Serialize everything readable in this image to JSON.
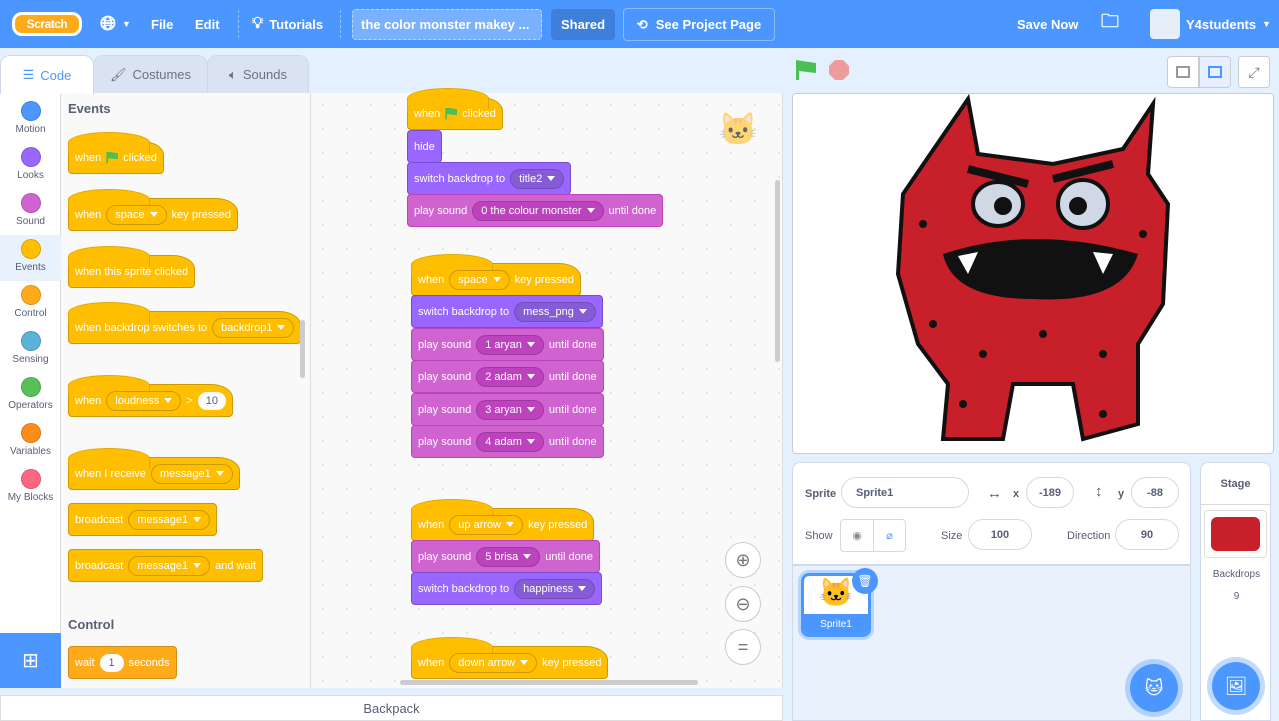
{
  "menubar": {
    "logo": "Scratch",
    "file": "File",
    "edit": "Edit",
    "tutorials": "Tutorials",
    "project_title": "the color monster makey ...",
    "shared": "Shared",
    "see_project_page": "See Project Page",
    "save_now": "Save Now",
    "username": "Y4students"
  },
  "tabs": [
    "Code",
    "Costumes",
    "Sounds"
  ],
  "categories": [
    {
      "label": "Motion",
      "color": "#4C97FF"
    },
    {
      "label": "Looks",
      "color": "#9966FF"
    },
    {
      "label": "Sound",
      "color": "#CF63CF"
    },
    {
      "label": "Events",
      "color": "#FFBF00"
    },
    {
      "label": "Control",
      "color": "#FFAB19"
    },
    {
      "label": "Sensing",
      "color": "#5CB1D6"
    },
    {
      "label": "Operators",
      "color": "#59C059"
    },
    {
      "label": "Variables",
      "color": "#FF8C1A"
    },
    {
      "label": "My Blocks",
      "color": "#FF6680"
    }
  ],
  "palette": {
    "events_heading": "Events",
    "control_heading": "Control",
    "blocks": [
      [
        {
          "t": "when"
        },
        {
          "icon": "flag"
        },
        {
          "t": "clicked"
        }
      ],
      [
        {
          "t": "when"
        },
        {
          "dd": "space"
        },
        {
          "t": "key pressed"
        }
      ],
      [
        {
          "t": "when this sprite clicked"
        }
      ],
      [
        {
          "t": "when backdrop switches to"
        },
        {
          "dd": "backdrop1"
        }
      ],
      [
        {
          "t": "when"
        },
        {
          "dd": "loudness"
        },
        {
          "t": ">"
        },
        {
          "num": "10"
        }
      ],
      [
        {
          "t": "when I receive"
        },
        {
          "dd": "message1"
        }
      ],
      [
        {
          "t": "broadcast"
        },
        {
          "dd": "message1"
        }
      ],
      [
        {
          "t": "broadcast"
        },
        {
          "dd": "message1"
        },
        {
          "t": "and wait"
        }
      ],
      [
        {
          "t": "wait"
        },
        {
          "num": "1"
        },
        {
          "t": "seconds"
        }
      ]
    ]
  },
  "scripts": [
    [
      {
        "t": "when"
      },
      {
        "icon": "flag"
      },
      {
        "t": "clicked"
      }
    ],
    [
      {
        "t": "hide"
      }
    ],
    [
      {
        "t": "switch backdrop to"
      },
      {
        "dd": "title2"
      }
    ],
    [
      {
        "t": "play sound"
      },
      {
        "dd": "0 the colour monster"
      },
      {
        "t": "until done"
      }
    ],
    [
      {
        "t": "when"
      },
      {
        "dd": "space"
      },
      {
        "t": "key pressed"
      }
    ],
    [
      {
        "t": "switch backdrop to"
      },
      {
        "dd": "mess_png"
      }
    ],
    [
      {
        "t": "play sound"
      },
      {
        "dd": "1 aryan"
      },
      {
        "t": "until done"
      }
    ],
    [
      {
        "t": "play sound"
      },
      {
        "dd": "2 adam"
      },
      {
        "t": "until done"
      }
    ],
    [
      {
        "t": "play sound"
      },
      {
        "dd": "3 aryan"
      },
      {
        "t": "until done"
      }
    ],
    [
      {
        "t": "play sound"
      },
      {
        "dd": "4 adam"
      },
      {
        "t": "until done"
      }
    ],
    [
      {
        "t": "when"
      },
      {
        "dd": "up arrow"
      },
      {
        "t": "key pressed"
      }
    ],
    [
      {
        "t": "play sound"
      },
      {
        "dd": "5 brisa"
      },
      {
        "t": "until done"
      }
    ],
    [
      {
        "t": "switch backdrop to"
      },
      {
        "dd": "happiness"
      }
    ],
    [
      {
        "t": "when"
      },
      {
        "dd": "down arrow"
      },
      {
        "t": "key pressed"
      }
    ]
  ],
  "backpack": "Backpack",
  "sprite_info": {
    "sprite_label": "Sprite",
    "sprite_name": "Sprite1",
    "x_label": "x",
    "x": "-189",
    "y_label": "y",
    "y": "-88",
    "show_label": "Show",
    "size_label": "Size",
    "size": "100",
    "direction_label": "Direction",
    "direction": "90"
  },
  "sprites": [
    {
      "name": "Sprite1",
      "selected": true
    }
  ],
  "stage_panel": {
    "title": "Stage",
    "backdrops_label": "Backdrops",
    "backdrops_count": "9"
  }
}
